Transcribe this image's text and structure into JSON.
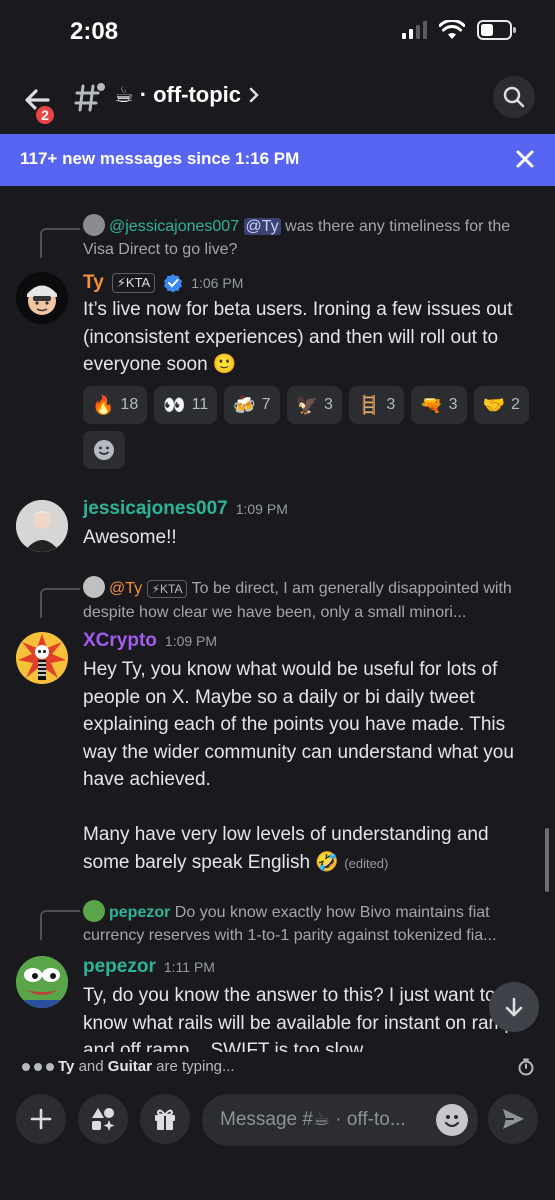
{
  "status_bar": {
    "time": "2:08"
  },
  "header": {
    "back_badge": "2",
    "channel_emoji": "☕",
    "channel_name": "off-topic"
  },
  "banner": {
    "text": "117+ new messages since 1:16 PM"
  },
  "messages": [
    {
      "reply": {
        "user": "@jessicajones007",
        "mention": "@Ty",
        "text": "was there any timeliness for the Visa Direct to go live?"
      },
      "author": "Ty",
      "author_color": "#f0913c",
      "tag": "⚡KTA",
      "verified": true,
      "time": "1:06 PM",
      "lines": [
        "It’s live now for beta users. Ironing a few issues out",
        "(inconsistent experiences) and then will roll out to",
        "everyone soon 🙂"
      ],
      "reactions": [
        {
          "emoji": "🔥",
          "count": "18"
        },
        {
          "emoji": "👀",
          "count": "11"
        },
        {
          "emoji": "🍻",
          "count": "7"
        },
        {
          "emoji": "🦅",
          "count": "3"
        },
        {
          "emoji": "🪜",
          "count": "3"
        },
        {
          "emoji": "🔫",
          "count": "3"
        },
        {
          "emoji": "🤝",
          "count": "2"
        }
      ]
    },
    {
      "author": "jessicajones007",
      "author_color": "#2ab598",
      "time": "1:09 PM",
      "lines": [
        "Awesome!!"
      ]
    },
    {
      "reply": {
        "user": "@Ty",
        "tag": "⚡KTA",
        "text": "To be direct, I am generally disappointed with despite how clear we have been, only a small minori..."
      },
      "author": "XCrypto",
      "author_color": "#a35cf0",
      "time": "1:09 PM",
      "lines": [
        "Hey Ty, you know what would be useful for lots of",
        "people on X. Maybe so a daily or bi daily tweet",
        "explaining each of the points you have made. This",
        "way the wider community can understand what you",
        "have achieved.",
        "",
        "Many have very low levels of understanding and",
        "some barely speak English 🤣"
      ],
      "edited": "(edited)"
    },
    {
      "reply": {
        "user": "pepezor",
        "text": "Do you know exactly how Bivo maintains fiat currency reserves with 1-to-1 parity against tokenized fia..."
      },
      "author": "pepezor",
      "author_color": "#2ab598",
      "time": "1:11 PM",
      "lines": [
        "Ty, do you know the answer to this? I just want to",
        "know what rails will be available for instant on ramp",
        "and off ramp... SWIFT is too slow"
      ]
    }
  ],
  "typing": {
    "user1": "Ty",
    "and": " and ",
    "user2": "Guitar",
    "suffix": " are typing..."
  },
  "composer": {
    "placeholder": "Message #☕ · off-to..."
  },
  "colors": {
    "accent": "#5865f2",
    "background": "#1a1a1e",
    "badge": "#ed4245"
  }
}
